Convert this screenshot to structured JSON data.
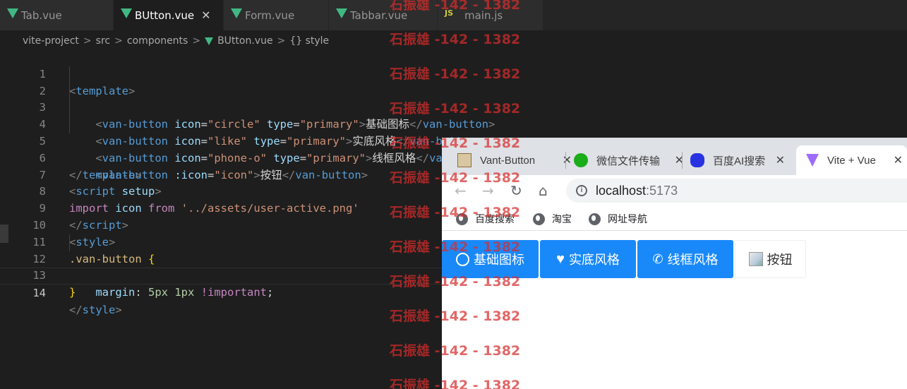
{
  "editor": {
    "tabs": [
      {
        "label": "Tab.vue",
        "icon": "vue-icon",
        "active": false
      },
      {
        "label": "BUtton.vue",
        "icon": "vue-icon",
        "active": true
      },
      {
        "label": "Form.vue",
        "icon": "vue-icon",
        "active": false
      },
      {
        "label": "Tabbar.vue",
        "icon": "vue-icon",
        "active": false
      },
      {
        "label": "main.js",
        "icon": "js-icon",
        "active": false
      }
    ],
    "js_badge": "JS",
    "close_glyph": "✕",
    "breadcrumb": {
      "project": "vite-project",
      "src": "src",
      "components": "components",
      "file": "BUtton.vue",
      "symbol": "{} style",
      "sep": ">"
    },
    "line_numbers": [
      "1",
      "2",
      "3",
      "4",
      "5",
      "6",
      "7",
      "8",
      "9",
      "10",
      "11",
      "12",
      "13",
      "14"
    ],
    "current_line": "14",
    "code": {
      "template_tag": "template",
      "van_button": "van-button",
      "icon_attr": "icon",
      "type_attr": "type",
      "bound_icon_attr": ":icon",
      "l2_icon": "\"circle\"",
      "l2_type": "\"primary\"",
      "l2_text": "基础图标",
      "l3_icon": "\"like\"",
      "l3_type": "\"primary\"",
      "l3_text": "实底风格",
      "l4_icon": "\"phone-o\"",
      "l4_type": "\"primary\"",
      "l4_text": "线框风格",
      "l5_icon": "\"icon\"",
      "l5_text": "按钮",
      "script_tag": "script",
      "setup_attr": "setup",
      "import_kw": "import",
      "import_name": "icon",
      "from_kw": "from",
      "import_path": "'../assets/user-active.png'",
      "style_tag": "style",
      "selector": ".van-button",
      "prop": "margin",
      "val1": "5px",
      "val2": "1px",
      "important": "!important"
    }
  },
  "browser": {
    "tabs": [
      {
        "label": "Vant-Button",
        "favicon": "vant-favicon"
      },
      {
        "label": "微信文件传输",
        "favicon": "wechat-favicon"
      },
      {
        "label": "百度AI搜索",
        "favicon": "baidu-favicon"
      },
      {
        "label": "Vite + Vue",
        "favicon": "vite-favicon"
      }
    ],
    "tab_close": "✕",
    "nav": {
      "back": "←",
      "forward": "→",
      "reload": "↻",
      "home": "⌂"
    },
    "address": {
      "host": "localhost",
      "port": ":5173"
    },
    "bookmarks": [
      "百度搜索",
      "淘宝",
      "网址导航"
    ],
    "buttons": [
      {
        "label": "基础图标",
        "icon": "circle-icon",
        "type": "primary"
      },
      {
        "label": "实底风格",
        "icon": "like-icon",
        "type": "primary"
      },
      {
        "label": "线框风格",
        "icon": "phone-icon",
        "type": "primary"
      },
      {
        "label": "按钮",
        "icon": "broken-image-icon",
        "type": "default"
      }
    ]
  },
  "watermark": "石振雄 -142 - 1382",
  "colors": {
    "editor_bg": "#1e1e1e",
    "vant_primary": "#1989fa",
    "watermark": "#d72d2d",
    "vue_green": "#41b883"
  }
}
